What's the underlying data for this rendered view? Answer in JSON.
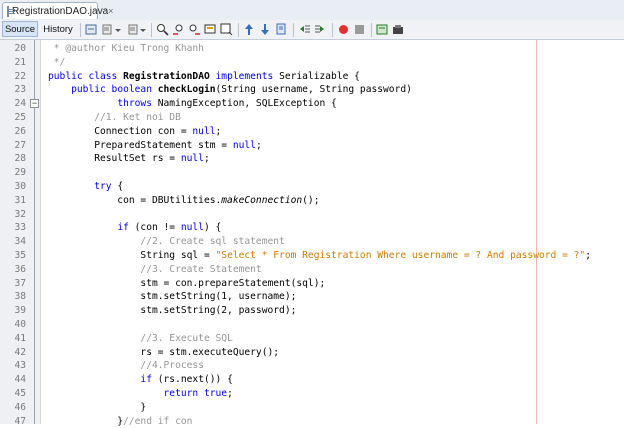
{
  "tab": {
    "title": "RegistrationDAO.java",
    "close": "×"
  },
  "toolbar": {
    "source_label": "Source",
    "history_label": "History"
  },
  "editor": {
    "lines": [
      {
        "n": "20",
        "c": " * @author Kieu Trong Khanh"
      },
      {
        "n": "21",
        "c": " */"
      },
      {
        "n": "22",
        "c": "public class RegistrationDAO implements Serializable {"
      },
      {
        "n": "23",
        "c": "    public boolean checkLogin(String username, String password)"
      },
      {
        "n": "24",
        "c": "            throws NamingException, SQLException {"
      },
      {
        "n": "25",
        "c": "        //1. Ket noi DB"
      },
      {
        "n": "26",
        "c": "        Connection con = null;"
      },
      {
        "n": "27",
        "c": "        PreparedStatement stm = null;"
      },
      {
        "n": "28",
        "c": "        ResultSet rs = null;"
      },
      {
        "n": "29",
        "c": ""
      },
      {
        "n": "30",
        "c": "        try {"
      },
      {
        "n": "31",
        "c": "            con = DBUtilities.makeConnection();"
      },
      {
        "n": "32",
        "c": ""
      },
      {
        "n": "33",
        "c": "            if (con != null) {"
      },
      {
        "n": "34",
        "c": "                //2. Create sql statement"
      },
      {
        "n": "35",
        "c": "                String sql = \"Select * From Registration Where username = ? And password = ?\";"
      },
      {
        "n": "36",
        "c": "                //3. Create Statement"
      },
      {
        "n": "37",
        "c": "                stm = con.prepareStatement(sql);"
      },
      {
        "n": "38",
        "c": "                stm.setString(1, username);"
      },
      {
        "n": "39",
        "c": "                stm.setString(2, password);"
      },
      {
        "n": "40",
        "c": ""
      },
      {
        "n": "41",
        "c": "                //3. Execute SQL"
      },
      {
        "n": "42",
        "c": "                rs = stm.executeQuery();"
      },
      {
        "n": "43",
        "c": "                //4.Process"
      },
      {
        "n": "44",
        "c": "                if (rs.next()) {"
      },
      {
        "n": "45",
        "c": "                    return true;"
      },
      {
        "n": "46",
        "c": "                }"
      },
      {
        "n": "47",
        "c": "            }//end if con"
      }
    ]
  }
}
